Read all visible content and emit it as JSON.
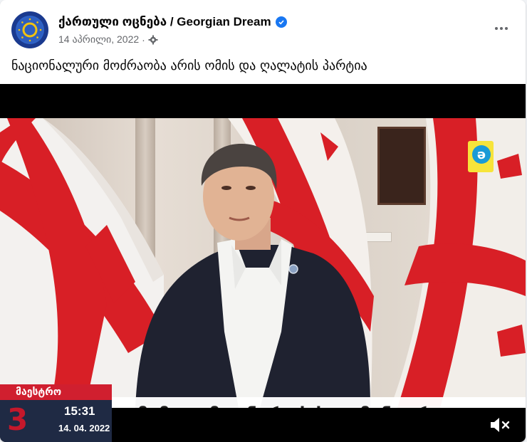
{
  "post": {
    "author": "ქართული ოცნება / Georgian Dream",
    "date": "14 აპრილი, 2022",
    "separator": "·",
    "text": "ნაციონალური მოძრაობა არის ომის და ღალატის პარტია"
  },
  "video": {
    "lower_third": {
      "tag": "მაესტრო",
      "time": "15:31",
      "date": "14. 04. 2022",
      "channel_number": "3",
      "title": "მამუკა მდინარაძის კომენტარი"
    },
    "channel_logo_glyph": "ə"
  },
  "icons": {
    "verified": "verified-badge-icon",
    "audience": "gear-icon",
    "more": "more-options-icon",
    "volume": "volume-muted-icon"
  },
  "colors": {
    "brand_blue": "#1877f2",
    "flag_red": "#d81f26",
    "tag_red": "#d01f2f"
  }
}
